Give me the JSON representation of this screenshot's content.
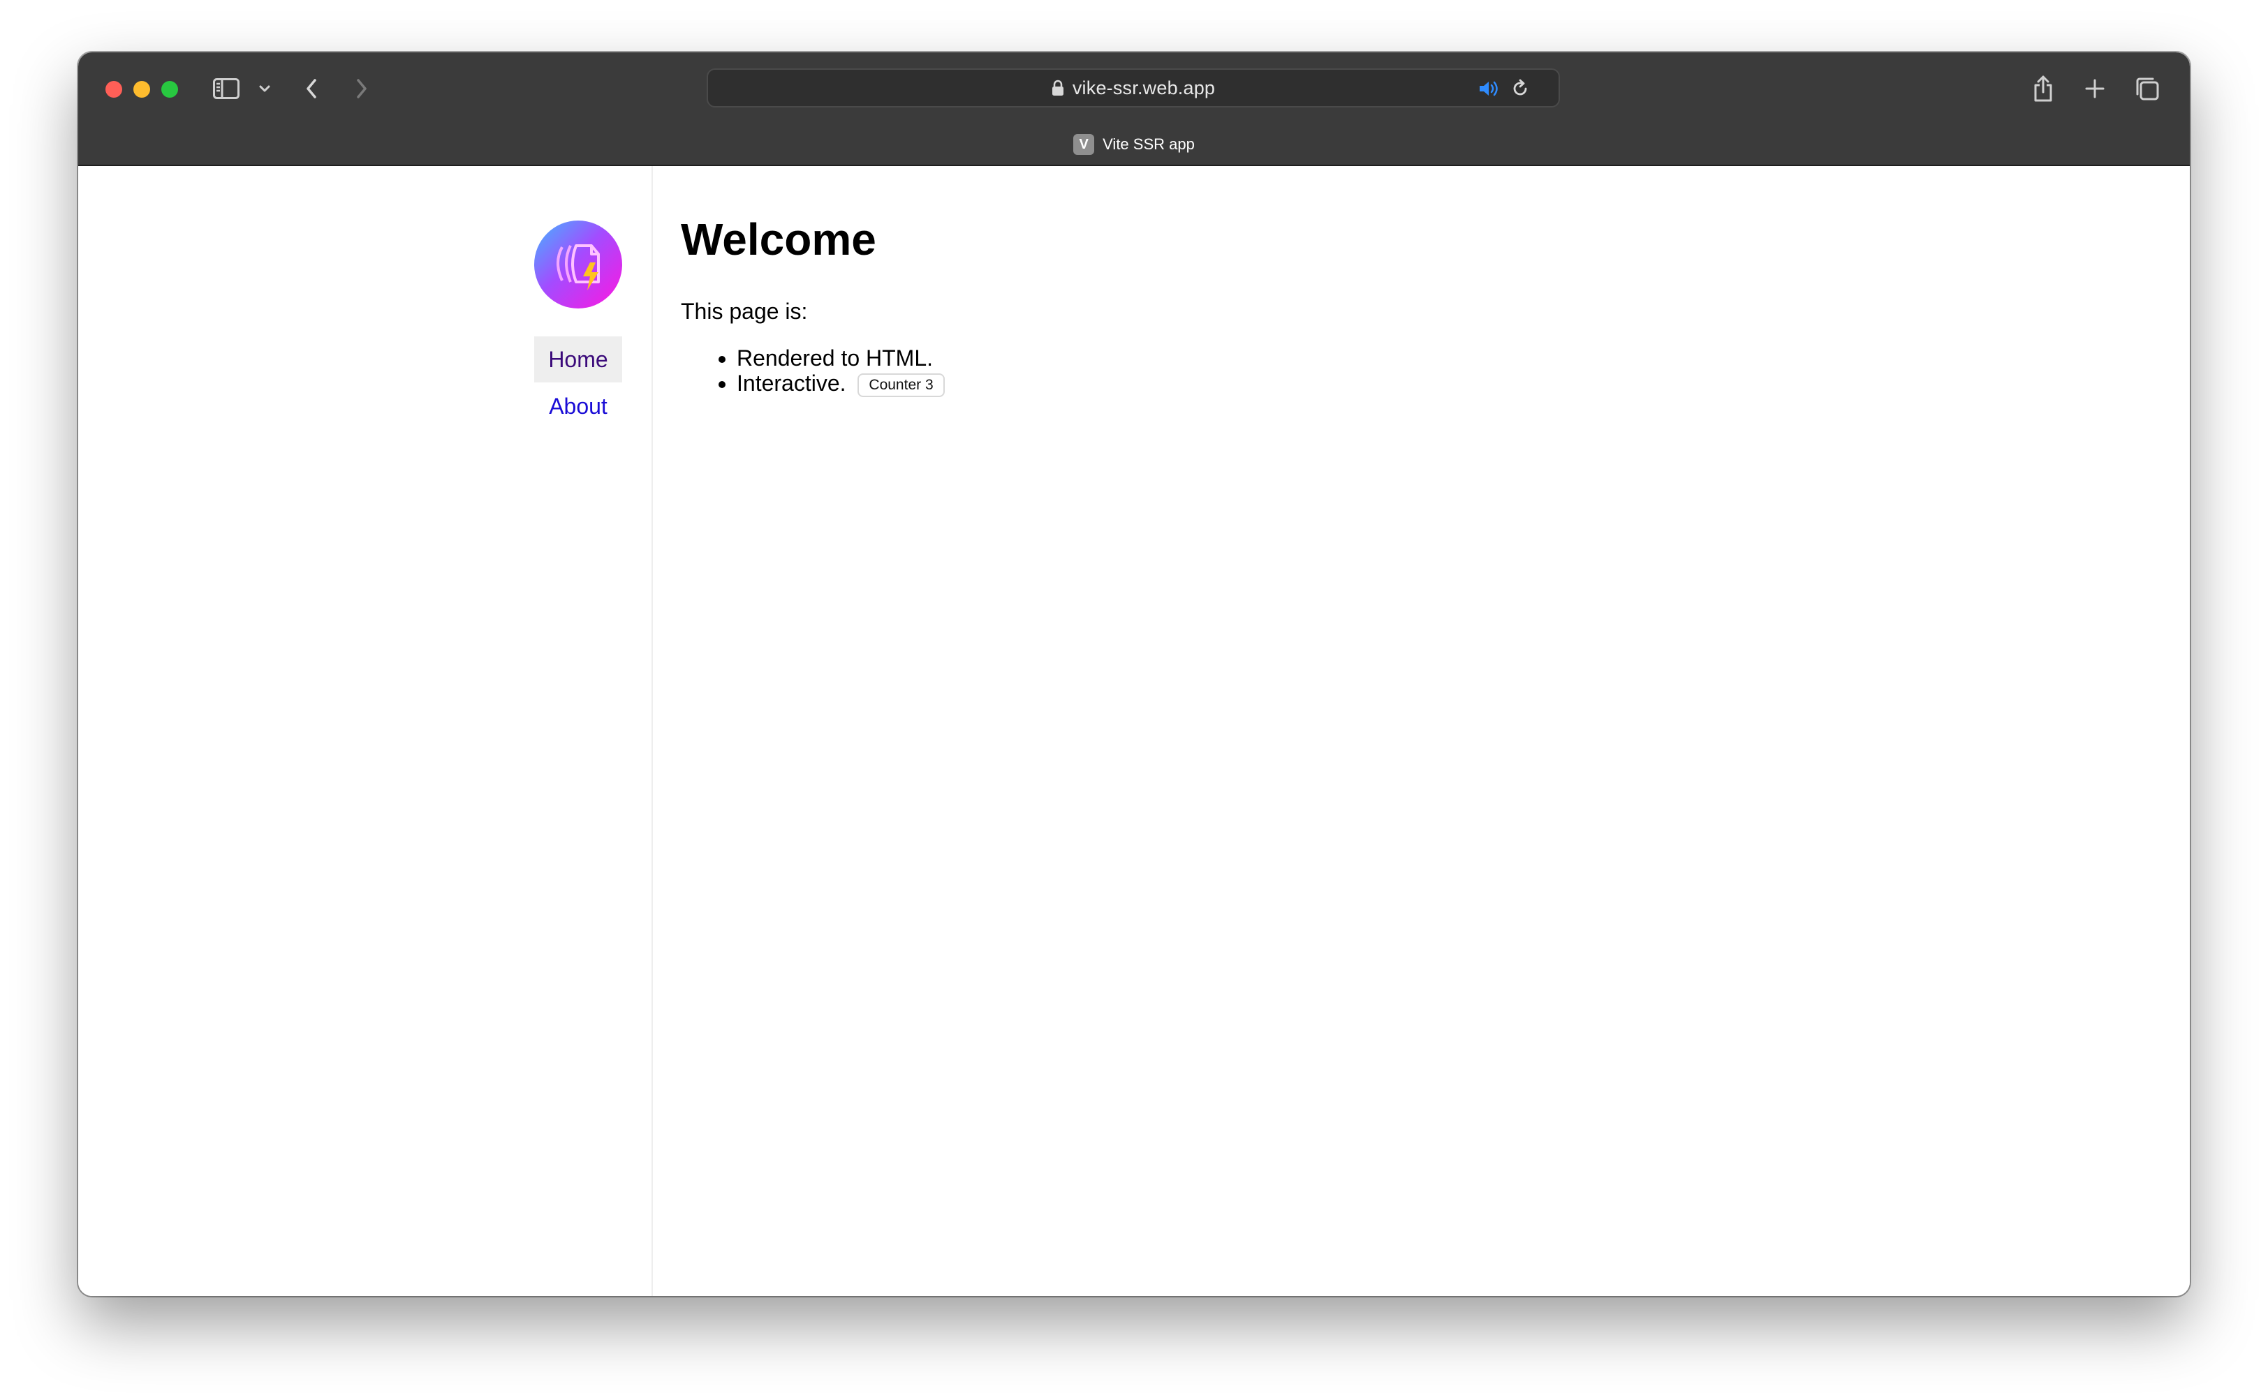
{
  "browser": {
    "url": "vike-ssr.web.app",
    "tab_title": "Vite SSR app",
    "favicon_letter": "V",
    "icons": {
      "sidebar": "sidebar-icon",
      "dropdown": "chevron-down-icon",
      "back": "chevron-left-icon",
      "forward": "chevron-right-icon",
      "lock": "lock-icon",
      "audio": "speaker-icon",
      "reload": "reload-icon",
      "share": "share-icon",
      "new_tab": "plus-icon",
      "tabs_overview": "tabs-overview-icon"
    },
    "colors": {
      "traffic_close": "#ff5f57",
      "traffic_minimize": "#febc2e",
      "traffic_zoom": "#28c840",
      "audio_accent": "#2f8cff"
    }
  },
  "sidebar": {
    "logo": "vike-logo-icon",
    "nav": [
      {
        "label": "Home",
        "active": true
      },
      {
        "label": "About",
        "active": false
      }
    ]
  },
  "main": {
    "heading": "Welcome",
    "intro": "This page is:",
    "list": [
      "Rendered to HTML.",
      "Interactive."
    ],
    "counter_label": "Counter 3"
  }
}
